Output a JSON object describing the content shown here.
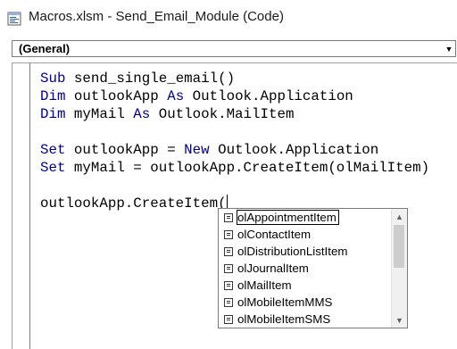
{
  "window": {
    "title": "Macros.xlsm - Send_Email_Module (Code)"
  },
  "procedure_combo": {
    "value": "(General)"
  },
  "code": {
    "lines": [
      [
        {
          "t": "Sub",
          "kw": true
        },
        {
          "t": " send_single_email()",
          "kw": false
        }
      ],
      [
        {
          "t": "Dim",
          "kw": true
        },
        {
          "t": " outlookApp ",
          "kw": false
        },
        {
          "t": "As",
          "kw": true
        },
        {
          "t": " Outlook.Application",
          "kw": false
        }
      ],
      [
        {
          "t": "Dim",
          "kw": true
        },
        {
          "t": " myMail ",
          "kw": false
        },
        {
          "t": "As",
          "kw": true
        },
        {
          "t": " Outlook.MailItem",
          "kw": false
        }
      ],
      [],
      [
        {
          "t": "Set",
          "kw": true
        },
        {
          "t": " outlookApp = ",
          "kw": false
        },
        {
          "t": "New",
          "kw": true
        },
        {
          "t": " Outlook.Application",
          "kw": false
        }
      ],
      [
        {
          "t": "Set",
          "kw": true
        },
        {
          "t": " myMail = outlookApp.CreateItem(olMailItem)",
          "kw": false
        }
      ],
      [],
      [
        {
          "t": "outlookApp.CreateItem(",
          "kw": false
        }
      ]
    ]
  },
  "autocomplete": {
    "selected_index": 0,
    "items": [
      "olAppointmentItem",
      "olContactItem",
      "olDistributionListItem",
      "olJournalItem",
      "olMailItem",
      "olMobileItemMMS",
      "olMobileItemSMS"
    ]
  },
  "colors": {
    "keyword": "#00008b",
    "text": "#000000"
  },
  "icons": {
    "title": "vba-module-icon",
    "list_item": "enum-constant-icon",
    "combo": "chevron-down-icon",
    "scroll_up": "scroll-up-icon",
    "scroll_down": "scroll-down-icon"
  }
}
